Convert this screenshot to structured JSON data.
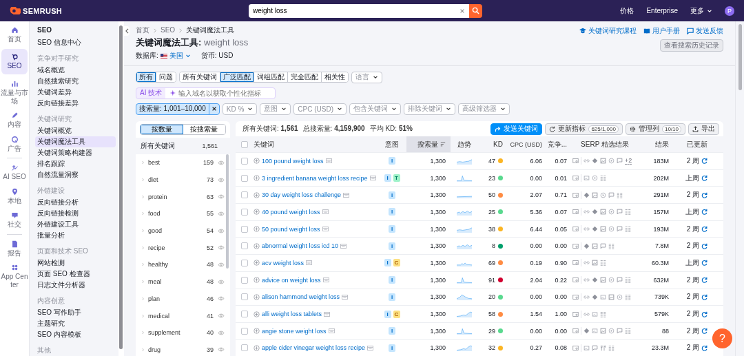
{
  "top_bar": {
    "logo": "SEMRUSH",
    "search": {
      "value": "weight loss"
    },
    "links": [
      "价格",
      "Enterprise"
    ],
    "more": "更多",
    "avatar": "P"
  },
  "nav_rail": [
    {
      "items": [
        {
          "label": "首页",
          "kind": "home",
          "selected": false
        },
        {
          "label": "SEO",
          "kind": "seo",
          "selected": true
        },
        {
          "label": "流量与市场",
          "kind": "traffic",
          "selected": false
        },
        {
          "label": "内容",
          "kind": "content",
          "selected": false
        },
        {
          "label": "广告",
          "kind": "ads",
          "selected": false
        }
      ]
    },
    {
      "items": [
        {
          "label": "AI SEO",
          "kind": "ai",
          "selected": false
        },
        {
          "label": "本地",
          "kind": "local",
          "selected": false
        },
        {
          "label": "社交",
          "kind": "social",
          "selected": false
        }
      ]
    },
    {
      "items": [
        {
          "label": "报告",
          "kind": "report",
          "selected": false
        },
        {
          "label": "App Center",
          "kind": "apps",
          "selected": false
        }
      ]
    }
  ],
  "sidebar": {
    "title": "SEO",
    "sections": [
      {
        "items": [
          {
            "label": "SEO 信息中心",
            "selected": false
          }
        ]
      },
      {
        "heading": "竞争对手研究",
        "items": [
          {
            "label": "域名概览",
            "selected": false
          },
          {
            "label": "自然搜索研究",
            "selected": false
          },
          {
            "label": "关键词差异",
            "selected": false
          },
          {
            "label": "反向链接差异",
            "selected": false
          }
        ]
      },
      {
        "heading": "关键词研究",
        "items": [
          {
            "label": "关键词概览",
            "selected": false
          },
          {
            "label": "关键词魔法工具",
            "selected": true
          },
          {
            "label": "关键词策略构建器",
            "selected": false
          },
          {
            "label": "排名跟踪",
            "selected": false
          },
          {
            "label": "自然流量洞察",
            "selected": false
          }
        ]
      },
      {
        "heading": "外链建设",
        "items": [
          {
            "label": "反向链接分析",
            "selected": false
          },
          {
            "label": "反向链接检测",
            "selected": false
          },
          {
            "label": "外链建设工具",
            "selected": false
          },
          {
            "label": "批量分析",
            "selected": false
          }
        ]
      },
      {
        "heading": "页面和技术 SEO",
        "items": [
          {
            "label": "网站检测",
            "selected": false
          },
          {
            "label": "页面 SEO 检查器",
            "selected": false
          },
          {
            "label": "日志文件分析器",
            "selected": false
          }
        ]
      },
      {
        "heading": "内容创意",
        "items": [
          {
            "label": "SEO 写作助手",
            "selected": false
          },
          {
            "label": "主题研究",
            "selected": false
          },
          {
            "label": "SEO 内容模板",
            "selected": false
          }
        ]
      },
      {
        "heading": "其他"
      }
    ]
  },
  "breadcrumb": [
    "首页",
    "SEO",
    "关键词魔法工具"
  ],
  "page_title": {
    "tool": "关键词魔法工具:",
    "query": "weight loss"
  },
  "database": {
    "label": "数据库:",
    "value": "美国"
  },
  "currency": "货币: USD",
  "header_links": [
    {
      "label": "关键词研究课程",
      "kind": "course"
    },
    {
      "label": "用户手册",
      "kind": "book"
    },
    {
      "label": "发送反馈",
      "kind": "feedback"
    }
  ],
  "history_button": "查看搜索历史记录",
  "filters": {
    "type_tabs": [
      {
        "label": "所有",
        "selected": true
      },
      {
        "label": "问题",
        "selected": false
      }
    ],
    "match_tabs": [
      {
        "label": "所有关键词",
        "selected": false
      },
      {
        "label": "广泛匹配",
        "selected": true
      },
      {
        "label": "词组匹配",
        "selected": false
      },
      {
        "label": "完全匹配",
        "selected": false
      },
      {
        "label": "相关性",
        "selected": false
      }
    ],
    "language": "语言",
    "ai": {
      "badge": "AI 技术",
      "placeholder": "输入域名以获取个性化指标"
    },
    "active_filter": "搜索量: 1,001–10,000",
    "dropdowns": [
      "KD %",
      "意图",
      "CPC (USD)",
      "包含关键词",
      "排除关键词",
      "高级筛选器"
    ]
  },
  "groups": {
    "tabs": [
      {
        "label": "按数量",
        "selected": true
      },
      {
        "label": "按搜索量",
        "selected": false
      }
    ],
    "header": {
      "label": "所有关键词",
      "count": "1,561"
    },
    "items": [
      {
        "label": "best",
        "count": "159"
      },
      {
        "label": "diet",
        "count": "73"
      },
      {
        "label": "protein",
        "count": "63"
      },
      {
        "label": "food",
        "count": "55"
      },
      {
        "label": "good",
        "count": "54"
      },
      {
        "label": "recipe",
        "count": "52"
      },
      {
        "label": "healthy",
        "count": "48"
      },
      {
        "label": "meal",
        "count": "48"
      },
      {
        "label": "plan",
        "count": "46"
      },
      {
        "label": "medical",
        "count": "41"
      },
      {
        "label": "supplement",
        "count": "40"
      },
      {
        "label": "drug",
        "count": "39"
      }
    ]
  },
  "table": {
    "summary": [
      "所有关键词: **1,561**",
      "总搜索量: **4,159,900**",
      "平均 KD: **51%**"
    ],
    "actions": [
      {
        "label": "发送关键词",
        "kind": "send"
      },
      {
        "label": "更新指标",
        "badge": "625/1,000",
        "kind": "refresh"
      },
      {
        "label": "管理列",
        "badge": "10/10",
        "kind": "gear"
      },
      {
        "label": "导出",
        "kind": "export"
      }
    ],
    "all_checked": false,
    "columns": [
      {
        "label": "关键词",
        "sorted": false
      },
      {
        "label": "意图",
        "sorted": false
      },
      {
        "label": "搜索量",
        "sorted": true
      },
      {
        "label": "趋势",
        "sorted": false
      },
      {
        "label": "KD",
        "sorted": false
      },
      {
        "label": "CPC (USD)",
        "sorted": false
      },
      {
        "label": "竞争...",
        "sorted": false
      },
      {
        "label": "SERP 精选结果",
        "sorted": false
      },
      {
        "label": "结果",
        "sorted": false
      },
      {
        "label": "已更新",
        "sorted": false
      }
    ],
    "rows": [
      {
        "checked": false,
        "keyword": "100 pound weight loss",
        "intents": [
          {
            "label": "I",
            "kind": "informational"
          }
        ],
        "volume": "1,300",
        "trend": {
          "kind": "flat"
        },
        "kd": "47",
        "color": "#fbb524",
        "cpc": "6.06",
        "competition": "0.07",
        "serp": [
          {
            "kind": "link"
          },
          {
            "kind": "diamond"
          },
          {
            "kind": "image"
          },
          {
            "kind": "video"
          },
          {
            "kind": "comment"
          }
        ],
        "serp_more": "+2",
        "results": "183M",
        "updated": "2 周"
      },
      {
        "checked": false,
        "keyword": "3 ingredient banana weight loss recipe",
        "intents": [
          {
            "label": "I",
            "kind": "informational"
          },
          {
            "label": "T",
            "kind": "transactional"
          }
        ],
        "volume": "1,300",
        "trend": {
          "kind": "peak"
        },
        "kd": "23",
        "color": "#59d98e",
        "cpc": "0.00",
        "competition": "0.01",
        "serp": [
          {
            "kind": "photo"
          },
          {
            "kind": "video"
          },
          {
            "kind": "list"
          }
        ],
        "results": "202M",
        "updated": "上周"
      },
      {
        "checked": false,
        "keyword": "30 day weight loss challenge",
        "intents": [
          {
            "label": "I",
            "kind": "informational"
          }
        ],
        "volume": "1,300",
        "trend": {
          "kind": "low"
        },
        "kd": "50",
        "color": "#ff8c43",
        "cpc": "2.07",
        "competition": "0.71",
        "serp": [
          {
            "kind": "diamond"
          },
          {
            "kind": "image"
          },
          {
            "kind": "video"
          },
          {
            "kind": "comment"
          },
          {
            "kind": "list"
          }
        ],
        "results": "291M",
        "updated": "2 周"
      },
      {
        "checked": false,
        "keyword": "40 pound weight loss",
        "intents": [
          {
            "label": "I",
            "kind": "informational"
          }
        ],
        "volume": "1,300",
        "trend": {
          "kind": "wave"
        },
        "kd": "25",
        "color": "#59d98e",
        "cpc": "5.36",
        "competition": "0.07",
        "serp": [
          {
            "kind": "link"
          },
          {
            "kind": "diamond"
          },
          {
            "kind": "image"
          },
          {
            "kind": "video"
          },
          {
            "kind": "comment"
          },
          {
            "kind": "list"
          }
        ],
        "results": "157M",
        "updated": "上周"
      },
      {
        "checked": false,
        "keyword": "50 pound weight loss",
        "intents": [
          {
            "label": "I",
            "kind": "informational"
          }
        ],
        "volume": "1,300",
        "trend": {
          "kind": "flat"
        },
        "kd": "38",
        "color": "#fbb524",
        "cpc": "6.44",
        "competition": "0.05",
        "serp": [
          {
            "kind": "link"
          },
          {
            "kind": "diamond"
          },
          {
            "kind": "image"
          },
          {
            "kind": "video"
          },
          {
            "kind": "comment"
          },
          {
            "kind": "list"
          }
        ],
        "results": "193M",
        "updated": "2 周"
      },
      {
        "checked": false,
        "keyword": "abnormal weight loss icd 10",
        "intents": [
          {
            "label": "I",
            "kind": "informational"
          }
        ],
        "volume": "1,300",
        "trend": {
          "kind": "wave"
        },
        "kd": "8",
        "color": "#009f6b",
        "cpc": "0.00",
        "competition": "0.00",
        "serp": [
          {
            "kind": "diamond"
          },
          {
            "kind": "image"
          },
          {
            "kind": "comment"
          },
          {
            "kind": "list"
          }
        ],
        "results": "7.8M",
        "updated": "2 周"
      },
      {
        "checked": false,
        "keyword": "acv weight loss",
        "intents": [
          {
            "label": "I",
            "kind": "informational"
          },
          {
            "label": "C",
            "kind": "commercial"
          }
        ],
        "volume": "1,300",
        "trend": {
          "kind": "ripple"
        },
        "kd": "69",
        "color": "#ff8c43",
        "cpc": "0.19",
        "competition": "0.90",
        "serp": [
          {
            "kind": "link"
          },
          {
            "kind": "image"
          },
          {
            "kind": "list"
          }
        ],
        "results": "60.3M",
        "updated": "上周"
      },
      {
        "checked": false,
        "keyword": "advice on weight loss",
        "intents": [
          {
            "label": "I",
            "kind": "informational"
          }
        ],
        "volume": "1,300",
        "trend": {
          "kind": "peak"
        },
        "kd": "91",
        "color": "#d1002f",
        "cpc": "2.04",
        "competition": "0.22",
        "serp": [
          {
            "kind": "link"
          },
          {
            "kind": "diamond"
          },
          {
            "kind": "image"
          },
          {
            "kind": "video"
          },
          {
            "kind": "comment"
          },
          {
            "kind": "list"
          }
        ],
        "results": "632M",
        "updated": "2 周"
      },
      {
        "checked": false,
        "keyword": "alison hammond weight loss",
        "intents": [
          {
            "label": "I",
            "kind": "informational"
          }
        ],
        "volume": "1,300",
        "trend": {
          "kind": "hump"
        },
        "kd": "20",
        "color": "#59d98e",
        "cpc": "0.00",
        "competition": "0.00",
        "serp": [
          {
            "kind": "link"
          },
          {
            "kind": "diamond"
          },
          {
            "kind": "photo"
          },
          {
            "kind": "image"
          },
          {
            "kind": "video"
          },
          {
            "kind": "list"
          }
        ],
        "results": "739K",
        "updated": "2 周"
      },
      {
        "checked": false,
        "keyword": "alli weight loss tablets",
        "intents": [
          {
            "label": "I",
            "kind": "informational"
          },
          {
            "label": "C",
            "kind": "commercial"
          }
        ],
        "volume": "1,300",
        "trend": {
          "kind": "rise"
        },
        "kd": "58",
        "color": "#ff8c43",
        "cpc": "1.54",
        "competition": "1.00",
        "serp": [
          {
            "kind": "link"
          },
          {
            "kind": "photo"
          },
          {
            "kind": "list"
          }
        ],
        "results": "579K",
        "updated": "2 周"
      },
      {
        "checked": false,
        "keyword": "angie stone weight loss",
        "intents": [
          {
            "label": "I",
            "kind": "informational"
          }
        ],
        "volume": "1,300",
        "trend": {
          "kind": "peak"
        },
        "kd": "29",
        "color": "#59d98e",
        "cpc": "0.00",
        "competition": "0.00",
        "serp": [
          {
            "kind": "diamond"
          },
          {
            "kind": "photo"
          },
          {
            "kind": "image"
          },
          {
            "kind": "video"
          },
          {
            "kind": "comment"
          },
          {
            "kind": "list"
          }
        ],
        "results": "88",
        "updated": "2 周"
      },
      {
        "checked": false,
        "keyword": "apple cider vinegar weight loss recipe",
        "intents": [
          {
            "label": "I",
            "kind": "informational"
          }
        ],
        "volume": "1,300",
        "trend": {
          "kind": "rise"
        },
        "kd": "32",
        "color": "#fbb524",
        "cpc": "0.27",
        "competition": "0.08",
        "serp": [
          {
            "kind": "photo"
          },
          {
            "kind": "comment"
          },
          {
            "kind": "fork"
          },
          {
            "kind": "list"
          }
        ],
        "results": "23.3M",
        "updated": "2 周"
      }
    ]
  },
  "help_button": "?"
}
